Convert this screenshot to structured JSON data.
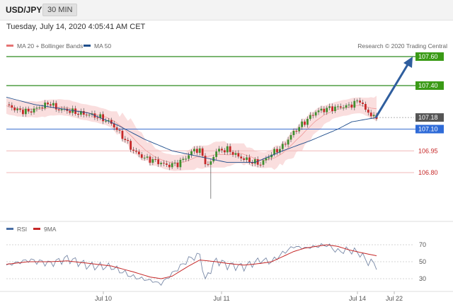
{
  "header": {
    "symbol": "USD/JPY",
    "timeframe": "30 MIN"
  },
  "timestamp": "Tuesday, July 14, 2020 4:05:41 AM CET",
  "copyright": "Research © 2020 Trading Central",
  "legend_main": [
    {
      "label": "MA 20 + Bollinger Bands",
      "color": "#e57373"
    },
    {
      "label": "MA 50",
      "color": "#1f4e8c"
    }
  ],
  "legend_rsi": [
    {
      "label": "RSI",
      "color": "#4a6fa5"
    },
    {
      "label": "9MA",
      "color": "#c62828"
    }
  ],
  "chart_data": [
    {
      "type": "line",
      "ylim": [
        106.66,
        107.66
      ],
      "x_ticks": [
        "Jul 10",
        "Jul 11",
        "Jul 14",
        "Jul 22"
      ],
      "levels": [
        {
          "value": 107.6,
          "label": "107.60",
          "kind": "resistance"
        },
        {
          "value": 107.4,
          "label": "107.40",
          "kind": "resistance"
        },
        {
          "value": 107.18,
          "label": "107.18",
          "kind": "current"
        },
        {
          "value": 107.1,
          "label": "107.10",
          "kind": "pivot"
        },
        {
          "value": 106.95,
          "label": "106.95",
          "kind": "support"
        },
        {
          "value": 106.8,
          "label": "106.80",
          "kind": "support"
        }
      ],
      "series": [
        {
          "name": "USD/JPY",
          "x": [
            0,
            4,
            8,
            12,
            16,
            18,
            22,
            26,
            30,
            34,
            38,
            42,
            46,
            50,
            54,
            58,
            62,
            66,
            68,
            70,
            73,
            76,
            80,
            84,
            88,
            92,
            96,
            100,
            104,
            108,
            112,
            116,
            120,
            124,
            128,
            130,
            134
          ],
          "values": [
            107.27,
            107.23,
            107.22,
            107.25,
            107.28,
            107.24,
            107.23,
            107.21,
            107.2,
            107.18,
            107.14,
            107.05,
            106.95,
            106.9,
            106.88,
            106.85,
            106.86,
            106.92,
            106.96,
            106.95,
            106.84,
            106.95,
            106.96,
            106.91,
            106.88,
            106.86,
            106.93,
            106.98,
            107.08,
            107.15,
            107.22,
            107.24,
            107.25,
            107.26,
            107.3,
            107.23,
            107.17
          ]
        },
        {
          "name": "MA 50",
          "x": [
            0,
            10,
            20,
            30,
            40,
            50,
            60,
            70,
            80,
            90,
            100,
            110,
            120,
            125,
            134
          ],
          "values": [
            107.32,
            107.27,
            107.24,
            107.21,
            107.13,
            107.03,
            106.95,
            106.91,
            106.87,
            106.87,
            106.95,
            107.02,
            107.1,
            107.15,
            107.18
          ]
        }
      ]
    },
    {
      "type": "line",
      "title": "RSI",
      "ylim": [
        20,
        80
      ],
      "y_ticks": [
        30,
        50,
        70
      ],
      "series": [
        {
          "name": "RSI",
          "x": [
            0,
            8,
            16,
            22,
            30,
            38,
            46,
            52,
            56,
            60,
            66,
            70,
            72,
            76,
            80,
            86,
            92,
            96,
            100,
            104,
            108,
            112,
            116,
            120,
            124,
            128,
            130,
            134
          ],
          "values": [
            46,
            52,
            48,
            54,
            45,
            44,
            32,
            28,
            24,
            36,
            53,
            58,
            30,
            52,
            46,
            44,
            52,
            50,
            60,
            68,
            66,
            68,
            70,
            62,
            64,
            60,
            52,
            46
          ]
        },
        {
          "name": "9MA",
          "x": [
            0,
            8,
            16,
            22,
            30,
            38,
            46,
            52,
            56,
            60,
            66,
            70,
            76,
            80,
            86,
            92,
            96,
            100,
            104,
            108,
            112,
            116,
            120,
            124,
            128,
            134
          ],
          "values": [
            47,
            50,
            50,
            51,
            48,
            45,
            38,
            32,
            30,
            33,
            45,
            52,
            50,
            48,
            46,
            48,
            50,
            56,
            62,
            66,
            68,
            70,
            68,
            64,
            61,
            57
          ]
        }
      ]
    }
  ]
}
